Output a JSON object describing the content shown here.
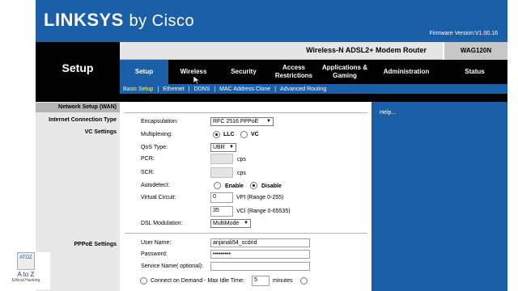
{
  "header": {
    "brand": "LINKSYS",
    "brand_suffix": "by Cisco",
    "firmware": "Firmware Version:V1.00.16",
    "product_name": "Wireless-N ADSL2+ Modem Router",
    "model": "WAG120N",
    "section_title": "Setup"
  },
  "tabs": [
    {
      "label": "Setup",
      "active": true
    },
    {
      "label": "Wireless",
      "active": false
    },
    {
      "label": "Security",
      "active": false
    },
    {
      "label": "Access Restrictions",
      "active": false
    },
    {
      "label": "Applications & Gaming",
      "active": false
    },
    {
      "label": "Administration",
      "active": false
    },
    {
      "label": "Status",
      "active": false
    }
  ],
  "subtabs": [
    "Basic Setup",
    "Ethernet",
    "DDNS",
    "MAC Address Clone",
    "Advanced Routing"
  ],
  "left": {
    "section": "Network Setup (WAN)",
    "conn_type": "Internet Connection Type",
    "vc_settings": "VC Settings",
    "pppoe_settings": "PPPoE Settings"
  },
  "form": {
    "encapsulation_label": "Encapsulation:",
    "encapsulation_value": "RFC 2516 PPPoE",
    "multiplexing_label": "Multiplexing:",
    "mux_llc": "LLC",
    "mux_vc": "VC",
    "qos_label": "QoS Type:",
    "qos_value": "UBR",
    "pcr_label": "PCR:",
    "pcr_unit": "cps",
    "scr_label": "SCR:",
    "scr_unit": "cps",
    "autodetect_label": "Autodetect:",
    "auto_enable": "Enable",
    "auto_disable": "Disable",
    "vc_label": "Virtual Circuit:",
    "vpi_value": "0",
    "vpi_range": "VPI (Range 0-255)",
    "vci_value": "35",
    "vci_range": "VCI (Range 0-65535)",
    "dsl_label": "DSL Modulation:",
    "dsl_value": "MultiMode",
    "username_label": "User Name:",
    "username_value": "anjanali54_scdrid",
    "password_label": "Password:",
    "password_value": "•••••••••",
    "service_label": "Service Name( optional):",
    "service_value": "",
    "connect_label": "Connect on Demand - Max Idle Time:",
    "idle_value": "5",
    "idle_unit": "minutes"
  },
  "help": "Help...",
  "watermark": {
    "title": "A to Z",
    "subtitle": "Ethical Hacking",
    "logo": "ATOZ"
  }
}
